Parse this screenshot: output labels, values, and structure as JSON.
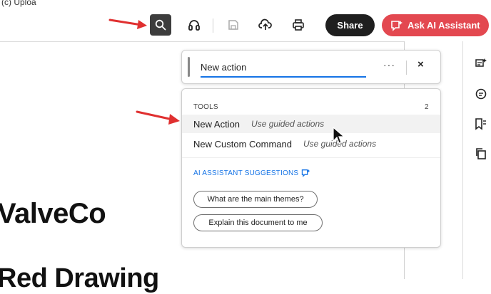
{
  "caption": "(c) Uploa",
  "toolbar": {
    "share_label": "Share",
    "ai_label": "Ask AI Assistant",
    "icons": [
      "search-icon",
      "headphones-icon",
      "save-icon",
      "upload-icon",
      "print-icon"
    ]
  },
  "document": {
    "heading1": "ValveCo",
    "heading2": "Red Drawing"
  },
  "search": {
    "value": "New action",
    "more_label": "···",
    "close_label": "×"
  },
  "results": {
    "tools_label": "TOOLS",
    "tools_count": "2",
    "items": [
      {
        "title": "New Action",
        "hint": "Use guided actions"
      },
      {
        "title": "New Custom Command",
        "hint": "Use guided actions"
      }
    ],
    "ai_suggestions_label": "AI ASSISTANT SUGGESTIONS",
    "chips": [
      "What are the main themes?",
      "Explain this document to me"
    ]
  },
  "colors": {
    "accent": "#1473e6",
    "ai_button": "#e34850",
    "annotation_arrow": "#e03030"
  }
}
